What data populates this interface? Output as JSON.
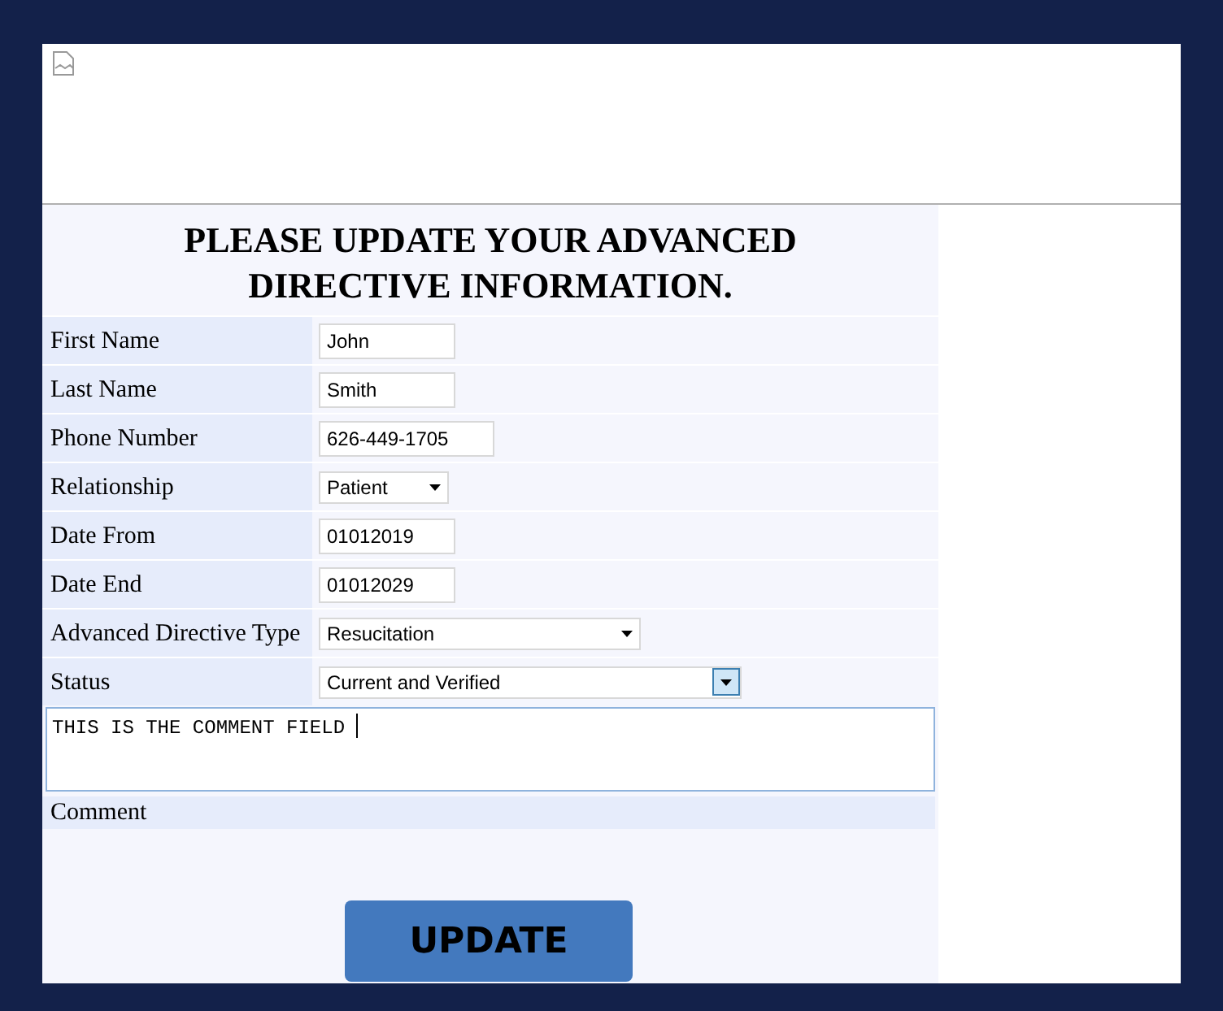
{
  "heading": "PLEASE UPDATE YOUR ADVANCED DIRECTIVE INFORMATION.",
  "fields": [
    {
      "label": "First Name",
      "kind": "text",
      "value": "John"
    },
    {
      "label": "Last Name",
      "kind": "text",
      "value": "Smith"
    },
    {
      "label": "Phone Number",
      "kind": "text",
      "value": "626-449-1705"
    },
    {
      "label": "Relationship",
      "kind": "select",
      "value": "Patient",
      "focused": false
    },
    {
      "label": "Date From",
      "kind": "text",
      "value": "01012019"
    },
    {
      "label": "Date End",
      "kind": "text",
      "value": "01012029"
    },
    {
      "label": "Advanced Directive Type",
      "kind": "select",
      "value": "Resucitation",
      "focused": false
    },
    {
      "label": "Status",
      "kind": "select",
      "value": "Current and Verified",
      "focused": true
    }
  ],
  "comment": {
    "value": "THIS IS THE COMMENT FIELD ",
    "label": "Comment"
  },
  "button": "UPDATE"
}
